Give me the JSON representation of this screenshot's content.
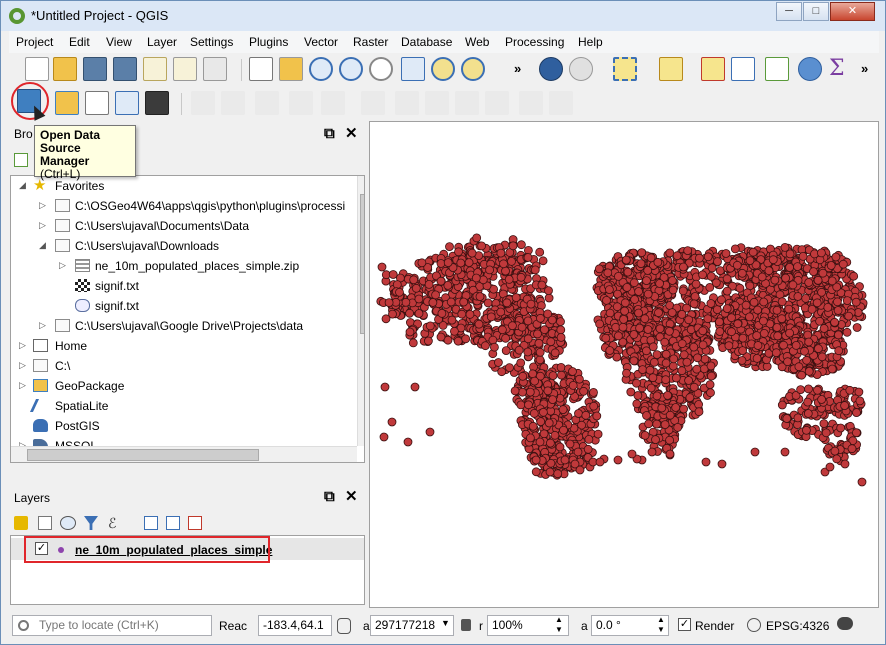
{
  "window": {
    "title": "*Untitled Project - QGIS",
    "minimize": "─",
    "maximize": "□",
    "close": "✕"
  },
  "menu": [
    "Project",
    "Edit",
    "View",
    "Layer",
    "Settings",
    "Plugins",
    "Vector",
    "Raster",
    "Database",
    "Web",
    "Processing",
    "Help"
  ],
  "toolbar": {
    "overflow": "»"
  },
  "tooltip": {
    "line1": "Open Data",
    "line2": "Source Manager",
    "line3": "(Ctrl+L)"
  },
  "browser": {
    "title": "Bro",
    "items": [
      {
        "label": "Favorites"
      },
      {
        "label": "C:\\OSGeo4W64\\apps\\qgis\\python\\plugins\\processi"
      },
      {
        "label": "C:\\Users\\ujaval\\Documents\\Data"
      },
      {
        "label": "C:\\Users\\ujaval\\Downloads"
      },
      {
        "label": "ne_10m_populated_places_simple.zip"
      },
      {
        "label": "signif.txt"
      },
      {
        "label": "signif.txt"
      },
      {
        "label": "C:\\Users\\ujaval\\Google Drive\\Projects\\data"
      },
      {
        "label": "Home"
      },
      {
        "label": "C:\\"
      },
      {
        "label": "GeoPackage"
      },
      {
        "label": "SpatiaLite"
      },
      {
        "label": "PostGIS"
      },
      {
        "label": "MSSQL"
      }
    ]
  },
  "layers": {
    "title": "Layers",
    "layer_name": "ne_10m_populated_places_simple",
    "checked": true
  },
  "status": {
    "locate_placeholder": "Type to locate (Ctrl+K)",
    "coord_label": "Reac",
    "coordinate": "-183.4,64.1",
    "scale_label": "a",
    "scale": "297177218",
    "mag_label": "r",
    "magnifier": "100%",
    "rotation_label": "a",
    "rotation": "0.0 °",
    "render_label": "Render",
    "crs": "EPSG:4326"
  },
  "colors": {
    "point_fill": "#c0393b",
    "point_stroke": "#3a1010",
    "highlight": "#e0262b"
  }
}
